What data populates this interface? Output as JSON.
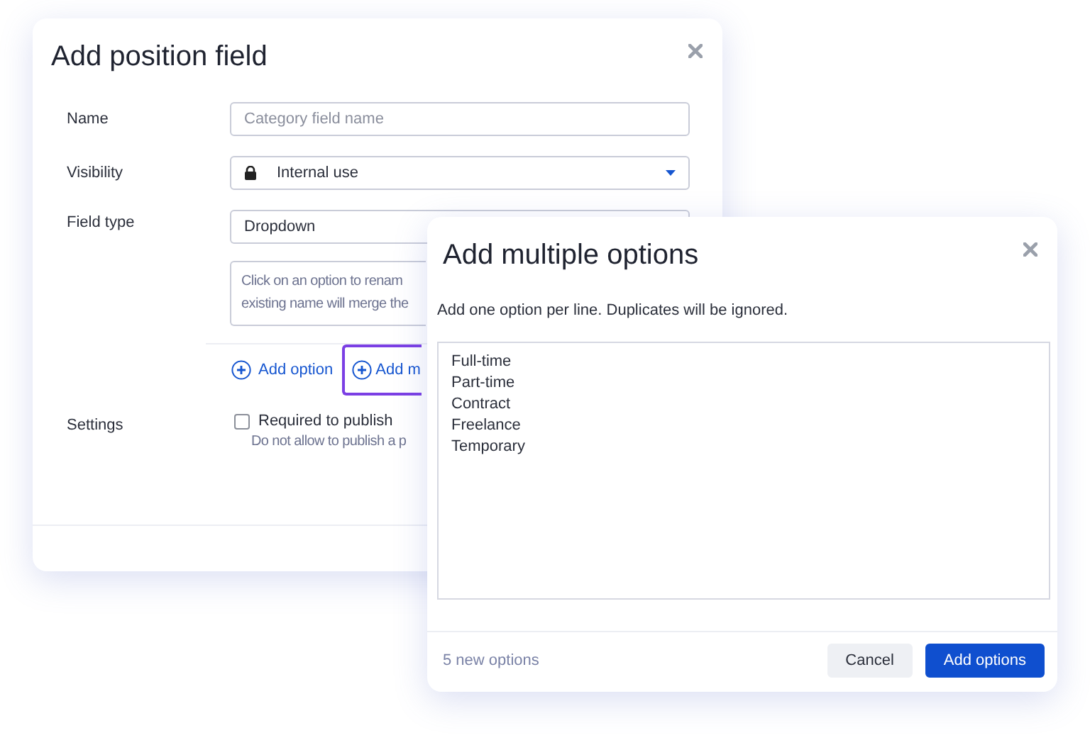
{
  "main_dialog": {
    "title": "Add position field",
    "name": {
      "label": "Name",
      "placeholder": "Category field name"
    },
    "visibility": {
      "label": "Visibility",
      "value": "Internal use"
    },
    "field_type": {
      "label": "Field type",
      "value": "Dropdown"
    },
    "hint": [
      "Click on an option to renam",
      "existing name will merge the"
    ],
    "actions": [
      {
        "label": "Add option",
        "selected": false
      },
      {
        "label": "Add m",
        "selected": true
      }
    ],
    "settings": {
      "label": "Settings",
      "checkbox": "Required to publish",
      "checked": false,
      "note": "Do not allow to publish a p"
    }
  },
  "options_dialog": {
    "title": "Add multiple options",
    "instruction": "Add one option per line. Duplicates will be ignored.",
    "lines": [
      "Full-time",
      "Part-time",
      "Contract",
      "Freelance",
      "Temporary"
    ],
    "count": "5 new options",
    "buttons": [
      {
        "label": "Cancel",
        "kind": "secondary"
      },
      {
        "label": "Add options",
        "kind": "primary"
      }
    ]
  }
}
